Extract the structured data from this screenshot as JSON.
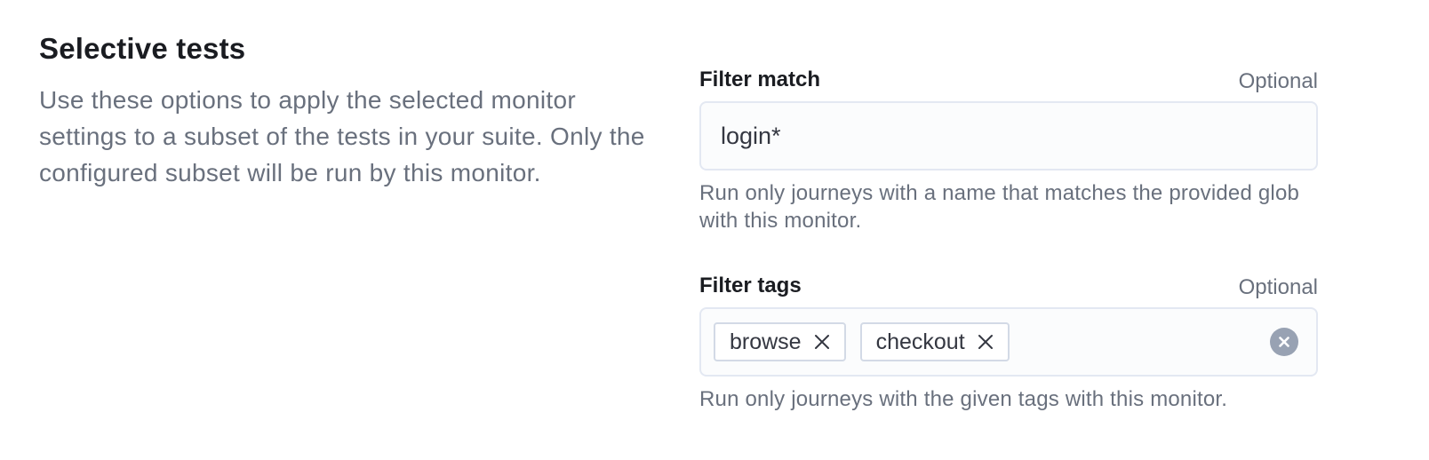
{
  "section": {
    "title": "Selective tests",
    "description": "Use these options to apply the selected monitor settings to a subset of the tests in your suite. Only the configured subset will be run by this monitor."
  },
  "filter_match": {
    "label": "Filter match",
    "optional": "Optional",
    "value": "login*",
    "help": "Run only journeys with a name that matches the provided glob with this monitor."
  },
  "filter_tags": {
    "label": "Filter tags",
    "optional": "Optional",
    "tags": [
      {
        "label": "browse",
        "remove_icon": "cross-icon"
      },
      {
        "label": "checkout",
        "remove_icon": "cross-icon"
      }
    ],
    "clear_icon": "clear-circle-icon",
    "help": "Run only journeys with the given tags with this monitor."
  },
  "colors": {
    "text_primary": "#1a1c21",
    "text_subdued": "#69707d",
    "field_bg": "#fbfcfd",
    "field_border": "#e3e8f2",
    "clear_button": "#98a2b3"
  }
}
